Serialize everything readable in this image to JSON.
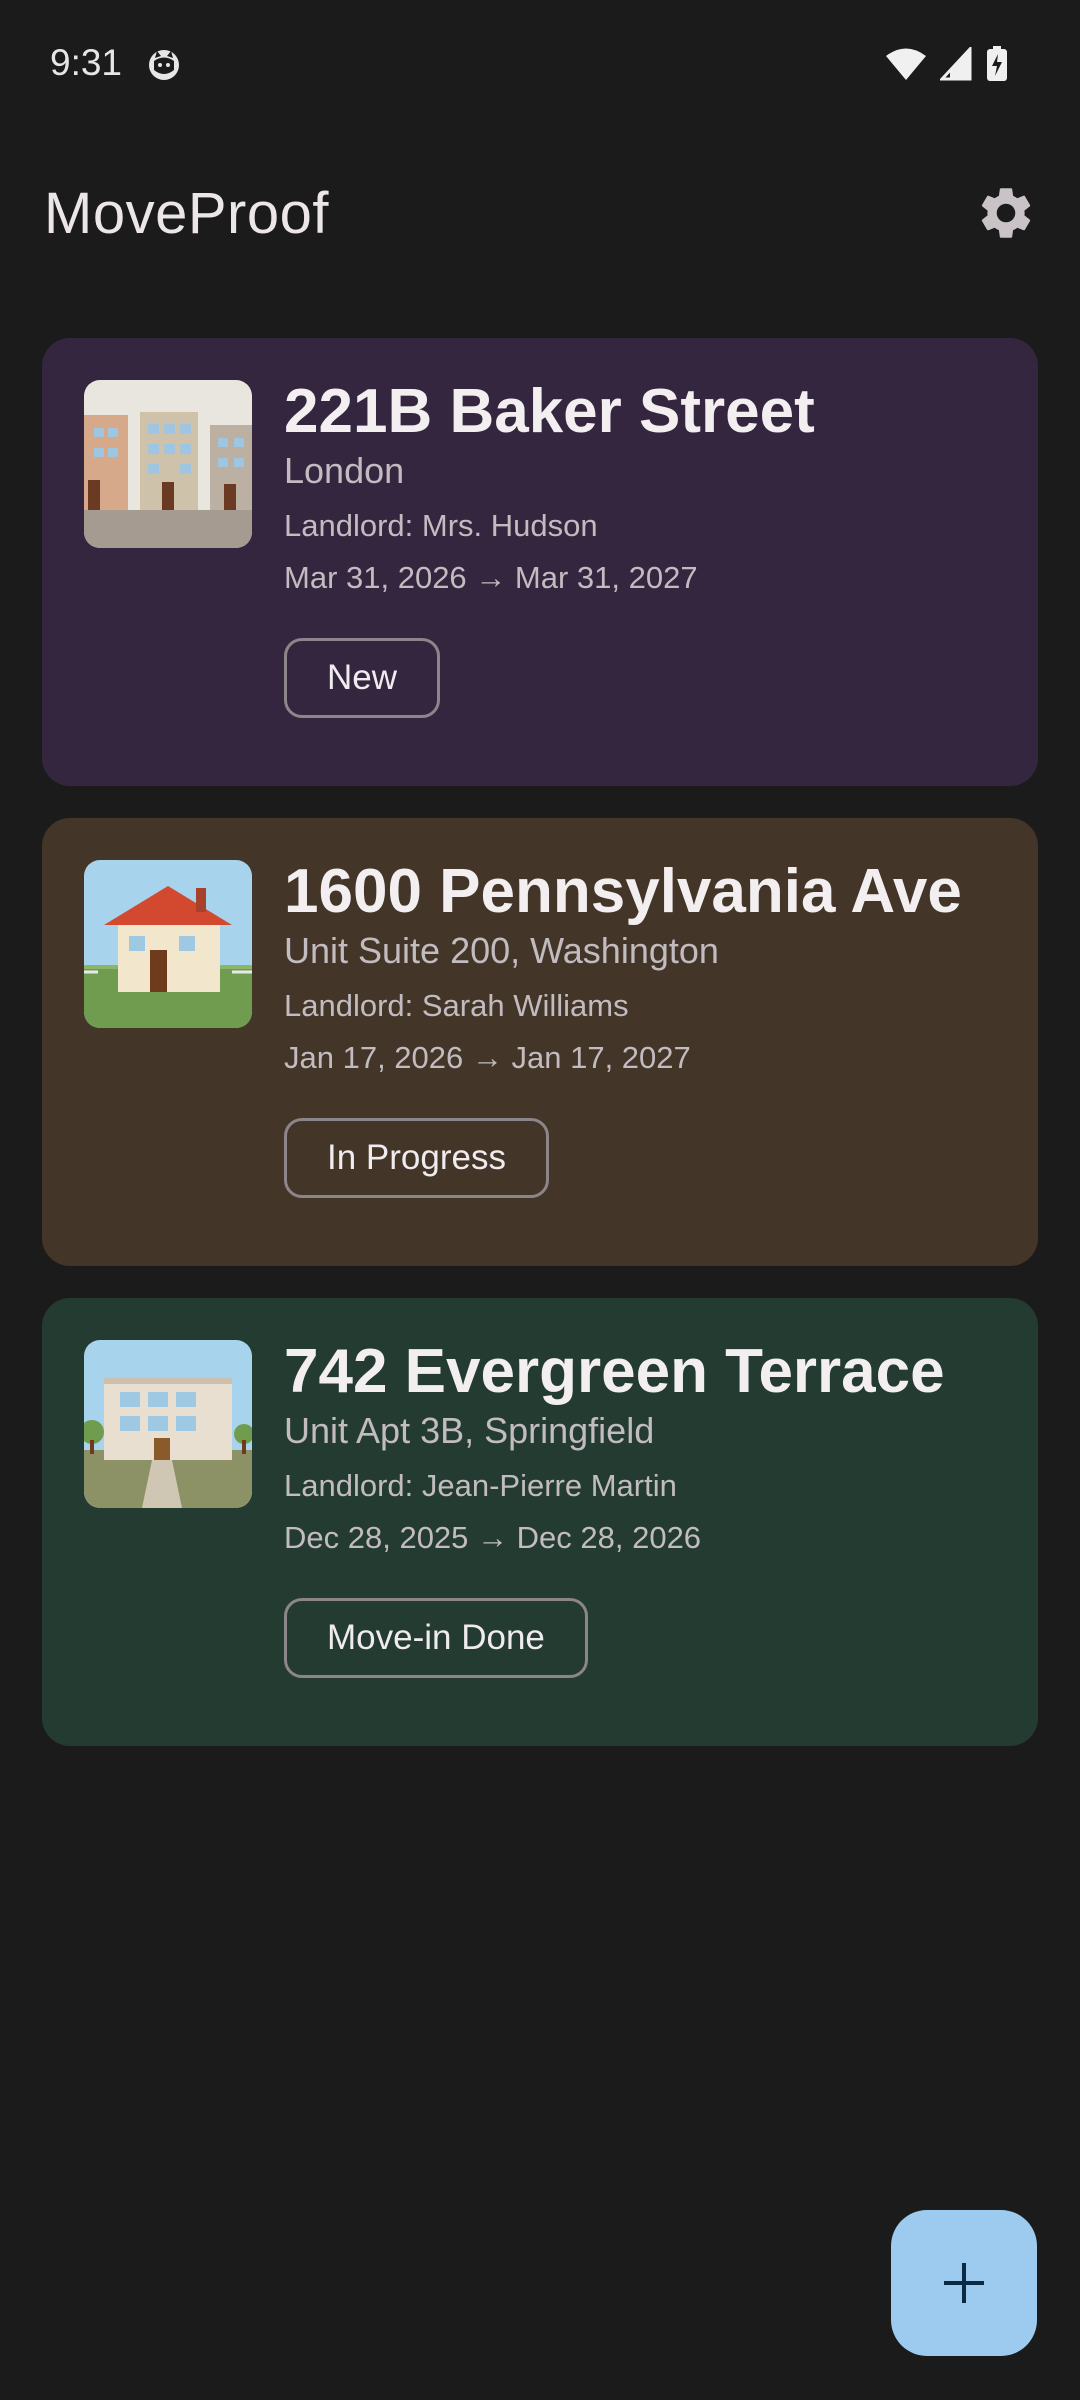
{
  "status_bar": {
    "time": "9:31"
  },
  "app_bar": {
    "title": "MoveProof"
  },
  "colors": {
    "background": "#1b1b1b",
    "card_new": "#352640",
    "card_in_progress": "#433628",
    "card_done": "#233b30",
    "fab": "#9ccbef"
  },
  "properties": [
    {
      "title": "221B Baker Street",
      "subtitle": "London",
      "landlord": "Landlord: Mrs. Hudson",
      "dates": "Mar 31, 2026 → Mar 31, 2027",
      "status": "New"
    },
    {
      "title": "1600 Pennsylvania Ave",
      "subtitle": "Unit Suite 200, Washington",
      "landlord": "Landlord: Sarah Williams",
      "dates": "Jan 17, 2026 → Jan 17, 2027",
      "status": "In Progress"
    },
    {
      "title": "742 Evergreen Terrace",
      "subtitle": "Unit Apt 3B, Springfield",
      "landlord": "Landlord: Jean-Pierre Martin",
      "dates": "Dec 28, 2025 → Dec 28, 2026",
      "status": "Move-in Done"
    }
  ],
  "icons": {
    "settings": "gear-icon",
    "add": "plus-icon"
  }
}
